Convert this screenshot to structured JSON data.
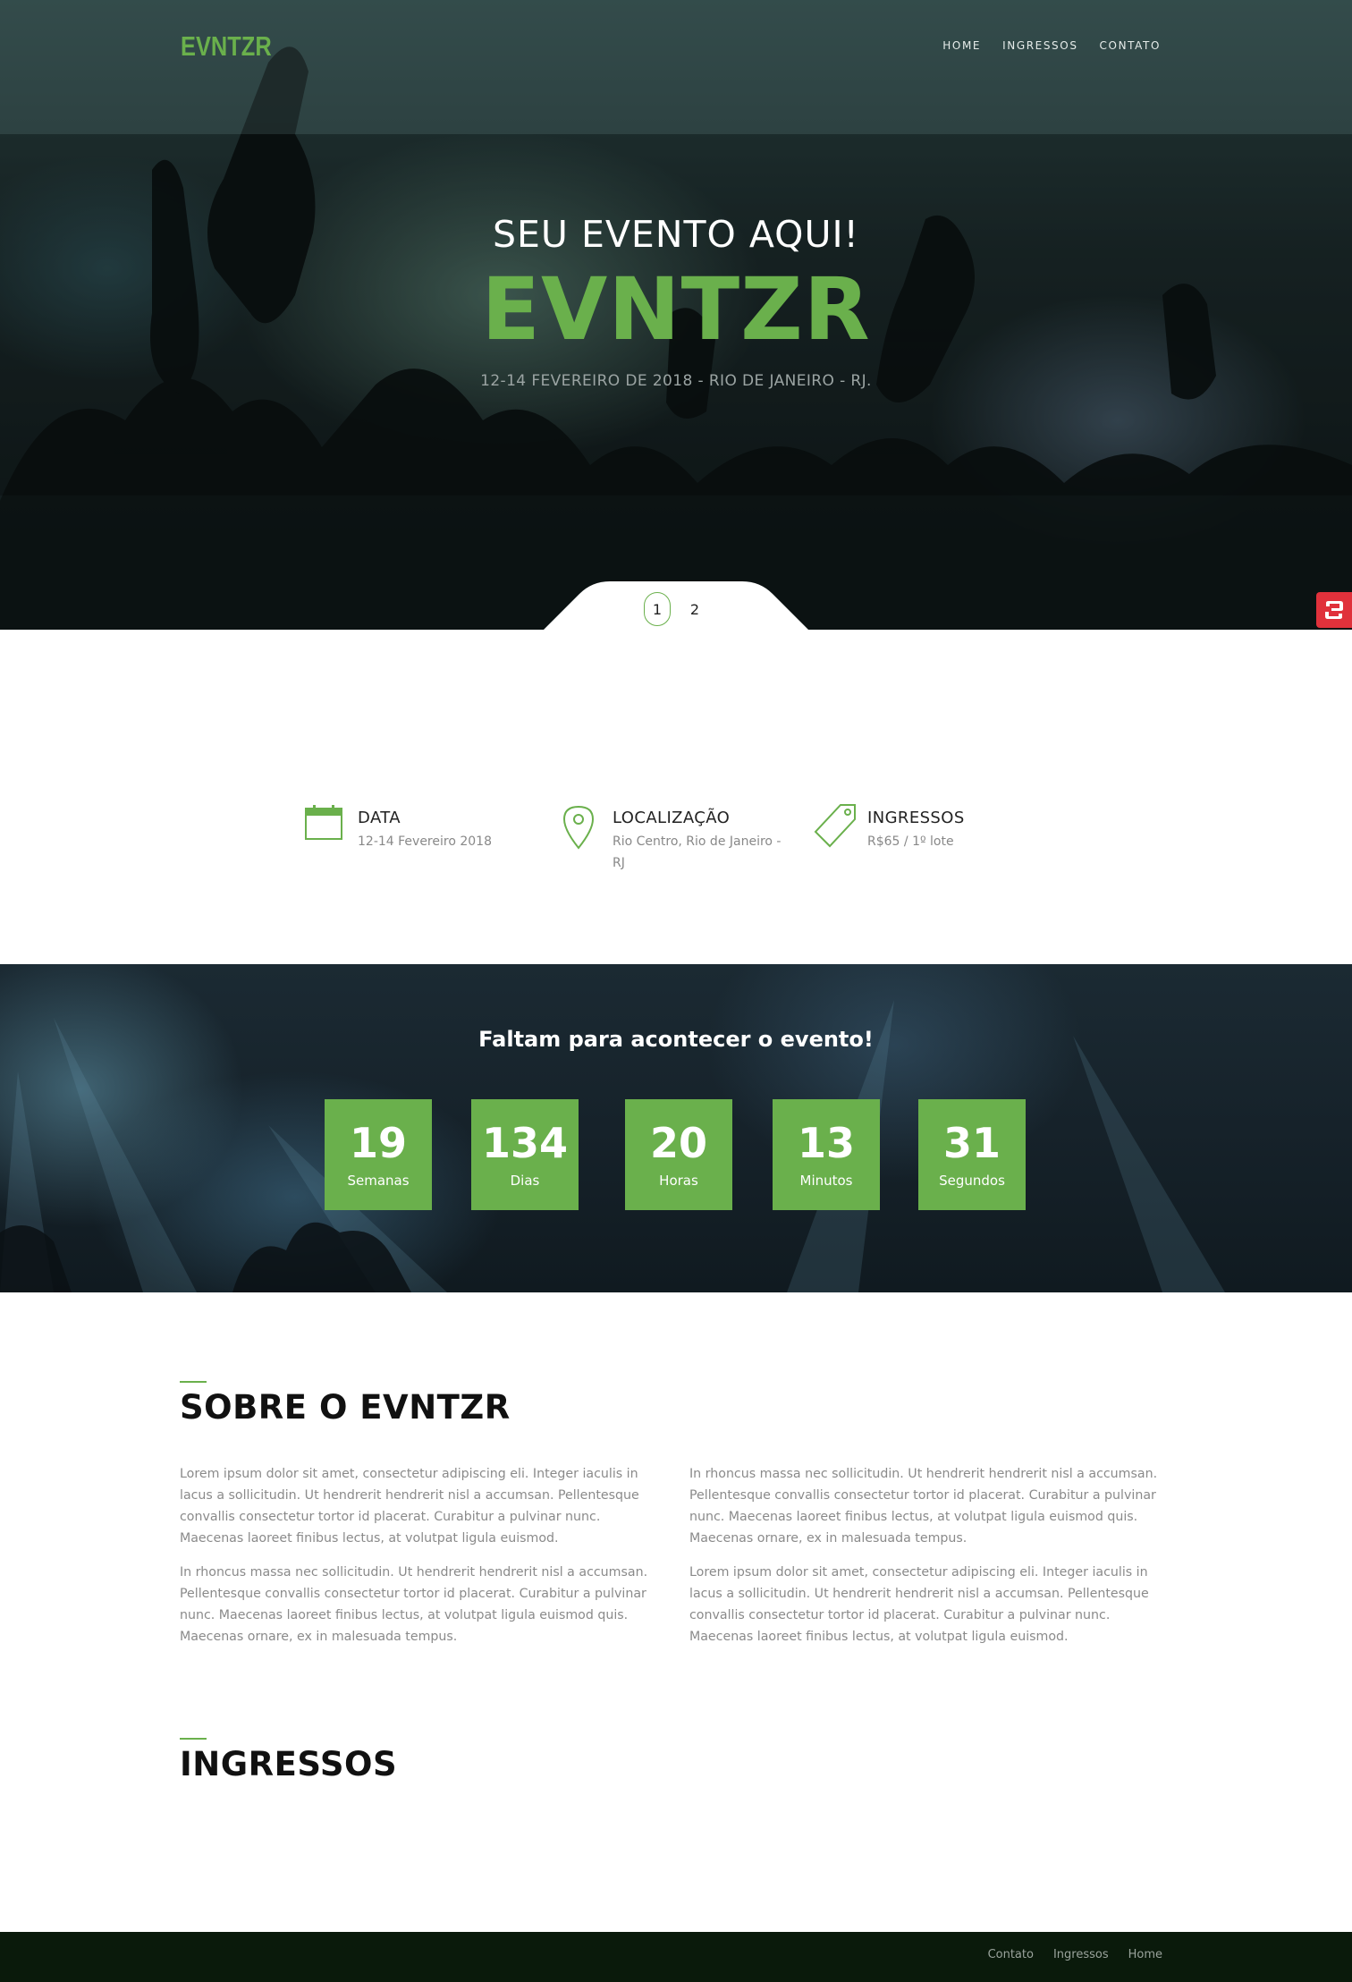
{
  "header": {
    "brand": "EVNTZR",
    "nav": [
      "HOME",
      "INGRESSOS",
      "CONTATO"
    ]
  },
  "hero": {
    "subtitle": "SEU EVENTO AQUI!",
    "title": "EVNTZR",
    "date_location": "12-14 FEVEREIRO DE 2018 - RIO DE JANEIRO - RJ.",
    "slides": [
      "1",
      "2"
    ],
    "active_slide": 1
  },
  "info": [
    {
      "icon": "calendar-icon",
      "title": "DATA",
      "value": "12-14 Fevereiro 2018"
    },
    {
      "icon": "location-pin-icon",
      "title": "LOCALIZAÇÃO",
      "value": "Rio Centro, Rio de Janeiro - RJ"
    },
    {
      "icon": "tag-icon",
      "title": "INGRESSOS",
      "value": "R$65 / 1º lote"
    }
  ],
  "countdown": {
    "title": "Faltam para acontecer o evento!",
    "units": [
      {
        "value": "19",
        "label": "Semanas"
      },
      {
        "value": "134",
        "label": "Dias"
      },
      {
        "value": "20",
        "label": "Horas"
      },
      {
        "value": "13",
        "label": "Minutos"
      },
      {
        "value": "31",
        "label": "Segundos"
      }
    ]
  },
  "about": {
    "title": "SOBRE O EVNTZR",
    "left": [
      "Lorem ipsum dolor sit amet, consectetur adipiscing eli. Integer iaculis in lacus a sollicitudin. Ut hendrerit hendrerit nisl a accumsan. Pellentesque convallis consectetur tortor id placerat. Curabitur a pulvinar nunc. Maecenas laoreet finibus lectus, at volutpat ligula euismod.",
      "In rhoncus massa nec sollicitudin. Ut hendrerit hendrerit nisl a accumsan. Pellentesque convallis consectetur tortor id placerat. Curabitur a pulvinar nunc. Maecenas laoreet finibus lectus, at volutpat ligula euismod quis. Maecenas ornare, ex in malesuada tempus."
    ],
    "right": [
      "In rhoncus massa nec sollicitudin. Ut hendrerit hendrerit nisl a accumsan. Pellentesque convallis consectetur tortor id placerat. Curabitur a pulvinar nunc. Maecenas laoreet finibus lectus, at volutpat ligula euismod quis. Maecenas ornare, ex in malesuada tempus.",
      "Lorem ipsum dolor sit amet, consectetur adipiscing eli. Integer iaculis in lacus a sollicitudin. Ut hendrerit hendrerit nisl a accumsan. Pellentesque convallis consectetur tortor id placerat. Curabitur a pulvinar nunc. Maecenas laoreet finibus lectus, at volutpat ligula euismod."
    ]
  },
  "tickets": {
    "title": "INGRESSOS"
  },
  "footer": {
    "links": [
      "Contato",
      "Ingressos",
      "Home"
    ]
  },
  "colors": {
    "accent": "#6ab04c",
    "footer": "#0a1a0b",
    "badge": "#e0313b"
  }
}
